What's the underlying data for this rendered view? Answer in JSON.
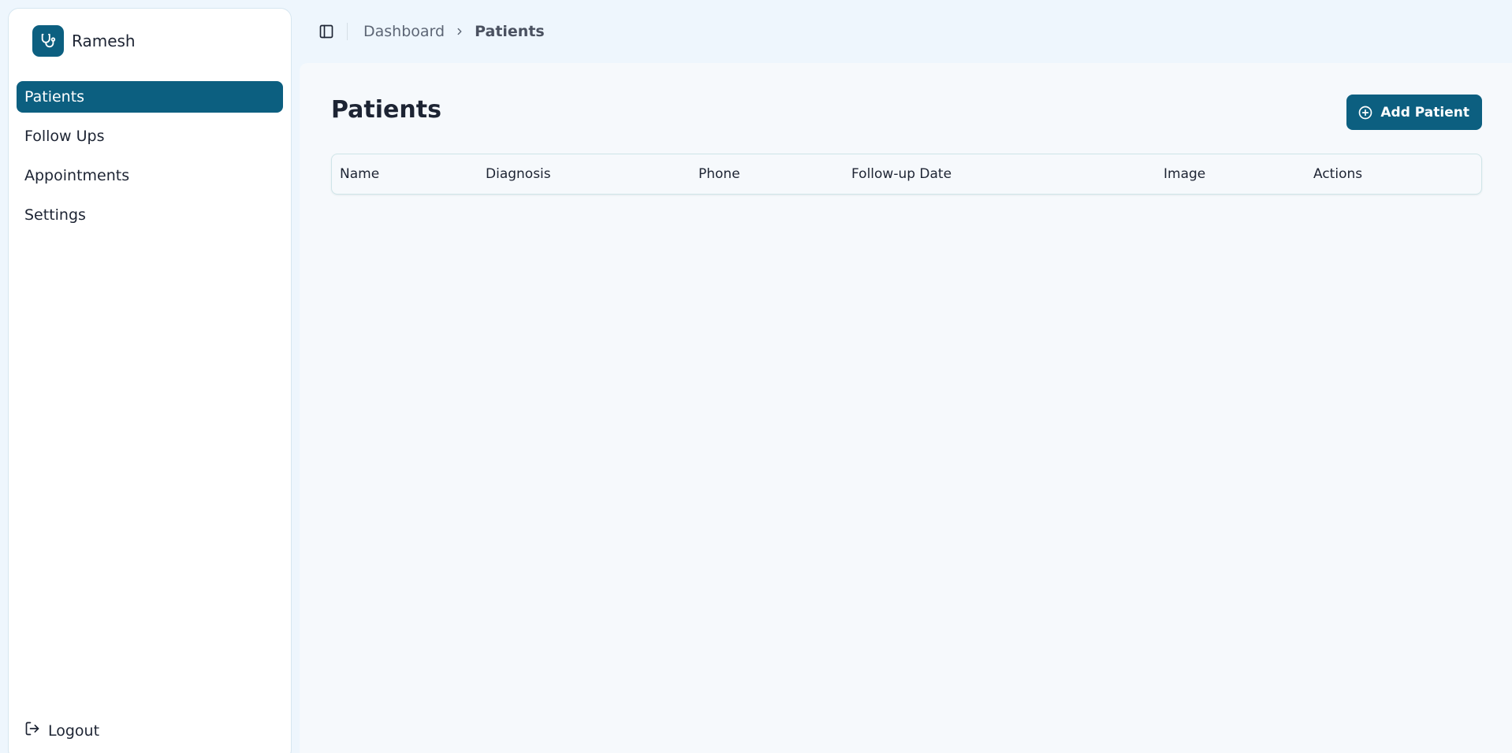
{
  "brand": {
    "name": "Ramesh",
    "icon": "stethoscope-icon"
  },
  "sidebar": {
    "items": [
      {
        "label": "Patients",
        "active": true
      },
      {
        "label": "Follow Ups",
        "active": false
      },
      {
        "label": "Appointments",
        "active": false
      },
      {
        "label": "Settings",
        "active": false
      }
    ],
    "logout": {
      "label": "Logout",
      "icon": "logout-icon"
    }
  },
  "header": {
    "toggle_icon": "sidebar-toggle-icon",
    "breadcrumb": [
      {
        "label": "Dashboard"
      },
      {
        "label": "Patients"
      }
    ]
  },
  "main": {
    "title": "Patients",
    "add_button": {
      "label": "Add Patient",
      "icon": "plus-circle-icon"
    },
    "table": {
      "columns": [
        "Name",
        "Diagnosis",
        "Phone",
        "Follow-up Date",
        "Image",
        "Actions"
      ],
      "rows": []
    }
  },
  "colors": {
    "accent": "#0c5f80",
    "page_background": "#eef6fd",
    "content_background": "#f6f9fc"
  }
}
